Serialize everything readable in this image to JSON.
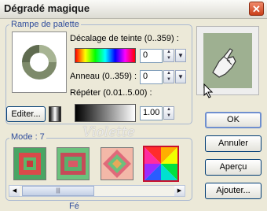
{
  "window": {
    "title": "Dégradé magique",
    "close_glyph": "✕"
  },
  "palette": {
    "group_label": "Rampe de palette",
    "hue_offset_label": "Décalage de teinte (0..359) :",
    "hue_offset_value": "0",
    "ring_label": "Anneau (0..359) :",
    "ring_value": "0",
    "repeat_label": "Répéter (0.01..5.00) :",
    "repeat_value": "1.00",
    "edit_label": "Editer..."
  },
  "mode": {
    "group_label": "Mode : 7",
    "selected_index": 3
  },
  "buttons": {
    "ok": "OK",
    "cancel": "Annuler",
    "preview": "Aperçu",
    "add": "Ajouter..."
  },
  "scrollbar": {
    "left_arrow": "◀",
    "right_arrow": "▶",
    "grip": "|||"
  },
  "watermark": "Violette",
  "bottom_clipped_text": "Fé"
}
